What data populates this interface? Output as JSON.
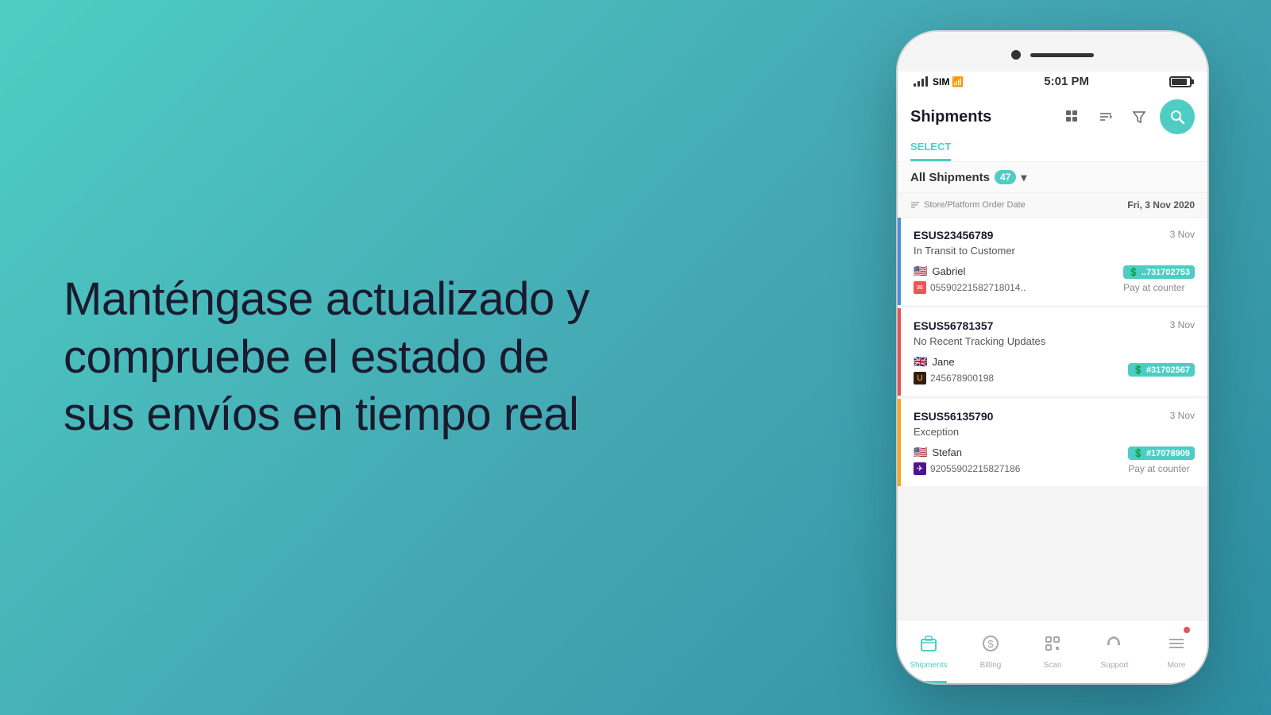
{
  "background": {
    "gradient_start": "#4ecdc4",
    "gradient_end": "#2d8fa3"
  },
  "left_text": {
    "headline": "Manténgase actualizado y compruebe el estado de sus envíos en tiempo real"
  },
  "phone": {
    "status_bar": {
      "carrier": "SIM",
      "wifi": "📶",
      "time": "5:01 PM",
      "battery_label": "battery"
    },
    "app_header": {
      "title": "Shipments",
      "select_label": "SELECT",
      "icons": [
        "grid-icon",
        "sort-icon",
        "filter-icon"
      ],
      "search_icon": "🔍"
    },
    "filter_bar": {
      "label": "All Shipments",
      "count": "47",
      "chevron": "▾"
    },
    "date_header": {
      "sort_label": "Store/Platform Order Date",
      "date": "Fri, 3 Nov 2020"
    },
    "shipments": [
      {
        "id": "ESUS23456789",
        "date": "3 Nov",
        "status": "In Transit to Customer",
        "status_color": "blue",
        "customer_flag": "🇺🇸",
        "customer_name": "Gabriel",
        "order_id": "..731702753",
        "tracking_number": "05590221582718014..",
        "carrier_icon": "mail",
        "payment": "Pay at counter"
      },
      {
        "id": "ESUS56781357",
        "date": "3 Nov",
        "status": "No Recent Tracking Updates",
        "status_color": "red",
        "customer_flag": "🇬🇧",
        "customer_name": "Jane",
        "order_id": "#31702567",
        "tracking_number": "245678900198",
        "carrier_icon": "ups",
        "payment": ""
      },
      {
        "id": "ESUS56135790",
        "date": "3 Nov",
        "status": "Exception",
        "status_color": "yellow",
        "customer_flag": "🇺🇸",
        "customer_name": "Stefan",
        "order_id": "#17078909",
        "tracking_number": "92055902215827186",
        "carrier_icon": "fedex",
        "payment": "Pay at counter"
      }
    ],
    "bottom_nav": [
      {
        "id": "shipments",
        "label": "Shipments",
        "icon": "📦",
        "active": true
      },
      {
        "id": "billing",
        "label": "Billing",
        "icon": "💲",
        "active": false
      },
      {
        "id": "scan",
        "label": "Scan",
        "icon": "⬜",
        "active": false
      },
      {
        "id": "support",
        "label": "Support",
        "icon": "🎧",
        "active": false
      },
      {
        "id": "more",
        "label": "More",
        "icon": "☰",
        "active": false,
        "badge": true
      }
    ]
  }
}
